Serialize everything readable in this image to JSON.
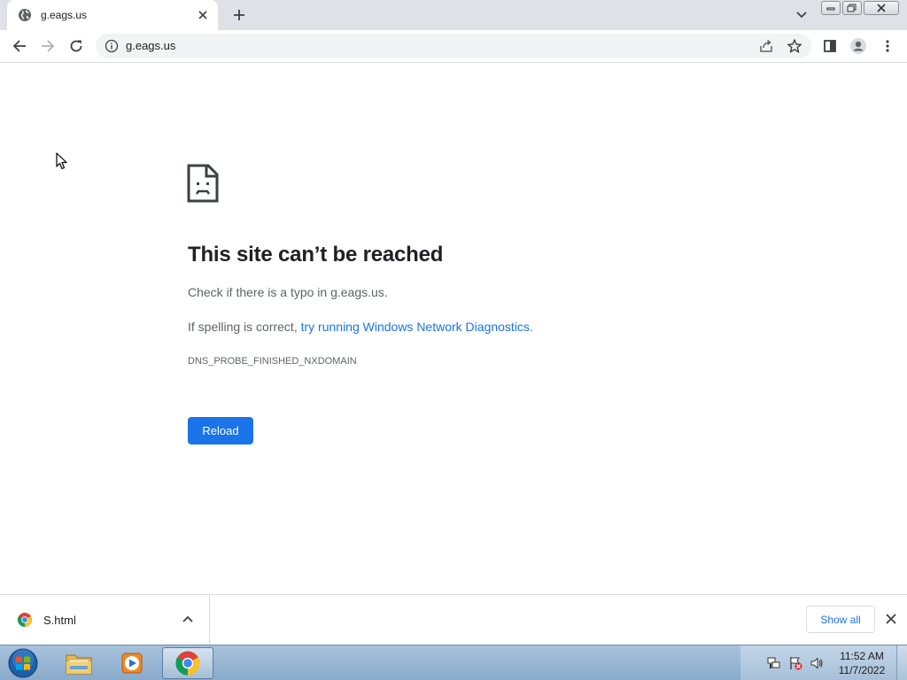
{
  "browser": {
    "tab": {
      "title": "g.eags.us"
    },
    "address_bar": {
      "url": "g.eags.us"
    },
    "icons": [
      "globe-icon",
      "close-icon",
      "plus-icon",
      "chevron-down-icon",
      "back-arrow-icon",
      "forward-arrow-icon",
      "reload-icon",
      "info-icon",
      "share-icon",
      "star-icon",
      "side-panel-icon",
      "profile-icon",
      "kebab-menu-icon"
    ]
  },
  "error_page": {
    "title": "This site can’t be reached",
    "line1": "Check if there is a typo in g.eags.us.",
    "line2_prefix": "If spelling is correct, ",
    "line2_link": "try running Windows Network Diagnostics",
    "line2_suffix": ".",
    "error_code": "DNS_PROBE_FINISHED_NXDOMAIN",
    "reload_label": "Reload"
  },
  "download_shelf": {
    "filename": "S.html",
    "show_all_label": "Show all"
  },
  "taskbar": {
    "apps": [
      "start-orb",
      "windows-explorer",
      "media-player",
      "google-chrome"
    ],
    "active_app": "google-chrome",
    "clock": {
      "time": "11:52 AM",
      "date": "11/7/2022"
    }
  },
  "colors": {
    "accent": "#1a73e8",
    "tabstrip": "#dee1e6",
    "omnibox": "#f1f3f4",
    "text_secondary": "#5f6368"
  }
}
